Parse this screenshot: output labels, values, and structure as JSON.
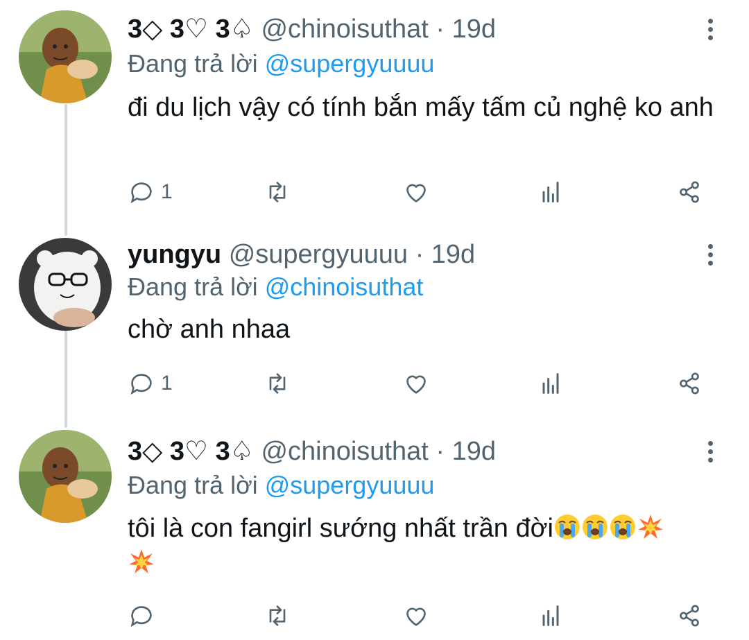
{
  "reply_prefix": "Đang trả lời",
  "tweets": [
    {
      "display_name": "3◇ 3♡ 3♤",
      "handle": "@chinoisuthat",
      "separator": "·",
      "time": "19d",
      "reply_to": "@supergyuuuu",
      "text": "đi du lịch vậy có tính bắn mấy tấm củ nghệ ko anh",
      "reply_count": "1",
      "avatar": "monk-avatar"
    },
    {
      "display_name": "yungyu",
      "handle": "@supergyuuuu",
      "separator": "·",
      "time": "19d",
      "reply_to": "@chinoisuthat",
      "text": "chờ anh nhaa",
      "reply_count": "1",
      "avatar": "bear-plush-avatar"
    },
    {
      "display_name": "3◇ 3♡ 3♤",
      "handle": "@chinoisuthat",
      "separator": "·",
      "time": "19d",
      "reply_to": "@supergyuuuu",
      "text": "tôi là con fangirl sướng nhất trần đời",
      "reply_count": "",
      "avatar": "monk-avatar",
      "emojis": [
        "loudly-crying-face",
        "loudly-crying-face",
        "loudly-crying-face",
        "collision",
        "collision"
      ]
    }
  ],
  "icons": {
    "reply": "comment-icon",
    "retweet": "retweet-icon",
    "like": "heart-icon",
    "analytics": "analytics-icon",
    "share": "share-icon",
    "more": "more-vertical-icon"
  },
  "colors": {
    "mention": "#1d9bf0",
    "secondary_text": "#536471",
    "thread_line": "#cfd9de"
  }
}
